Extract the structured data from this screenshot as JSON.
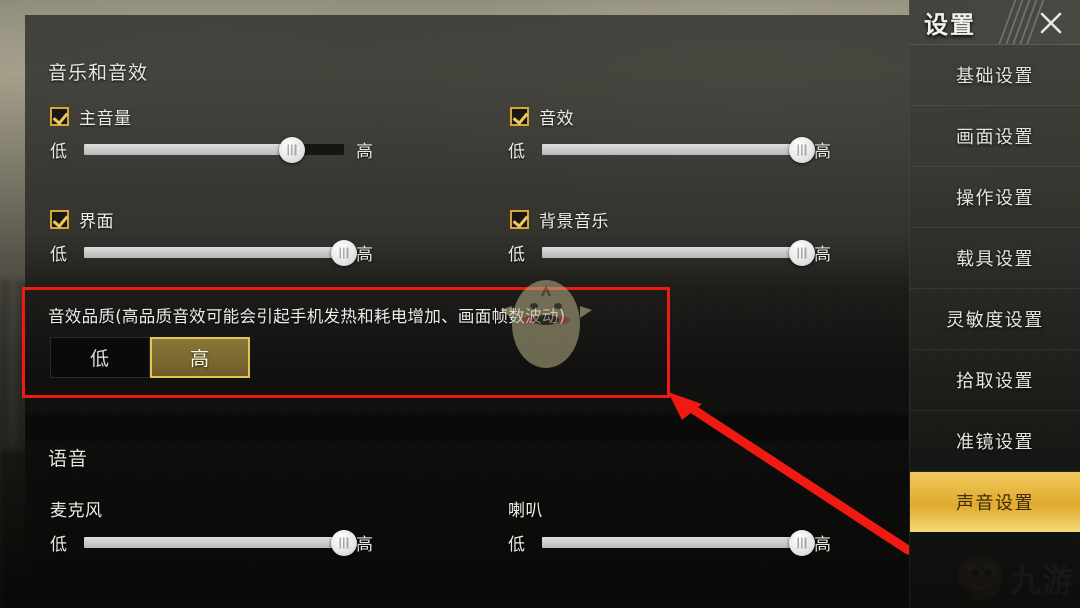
{
  "sidebar": {
    "title": "设置",
    "close_icon": "close-x-icon",
    "items": [
      {
        "label": "基础设置",
        "active": false
      },
      {
        "label": "画面设置",
        "active": false
      },
      {
        "label": "操作设置",
        "active": false
      },
      {
        "label": "载具设置",
        "active": false
      },
      {
        "label": "灵敏度设置",
        "active": false
      },
      {
        "label": "拾取设置",
        "active": false
      },
      {
        "label": "准镜设置",
        "active": false
      },
      {
        "label": "声音设置",
        "active": true
      }
    ]
  },
  "audio_section": {
    "title": "音乐和音效",
    "controls": [
      {
        "label": "主音量",
        "checked": true,
        "low": "低",
        "high": "高",
        "value": 80
      },
      {
        "label": "音效",
        "checked": true,
        "low": "低",
        "high": "高",
        "value": 100
      },
      {
        "label": "界面",
        "checked": true,
        "low": "低",
        "high": "高",
        "value": 100
      },
      {
        "label": "背景音乐",
        "checked": true,
        "low": "低",
        "high": "高",
        "value": 100
      }
    ]
  },
  "quality_section": {
    "description": "音效品质(高品质音效可能会引起手机发热和耗电增加、画面帧数波动)",
    "options": [
      {
        "label": "低",
        "selected": false
      },
      {
        "label": "高",
        "selected": true
      }
    ],
    "highlight_color": "#f01a12"
  },
  "voice_section": {
    "title": "语音",
    "controls": [
      {
        "label": "麦克风",
        "low": "低",
        "high": "高",
        "value": 100
      },
      {
        "label": "喇叭",
        "low": "低",
        "high": "高",
        "value": 100
      }
    ]
  },
  "watermarks": {
    "mascot_icon": "chick-mascot-icon",
    "logo_icon": "jiuyou-mascot-icon",
    "logo_text": "九游"
  },
  "annotation": {
    "arrow_icon": "red-arrow-icon",
    "color": "#f01a12"
  }
}
